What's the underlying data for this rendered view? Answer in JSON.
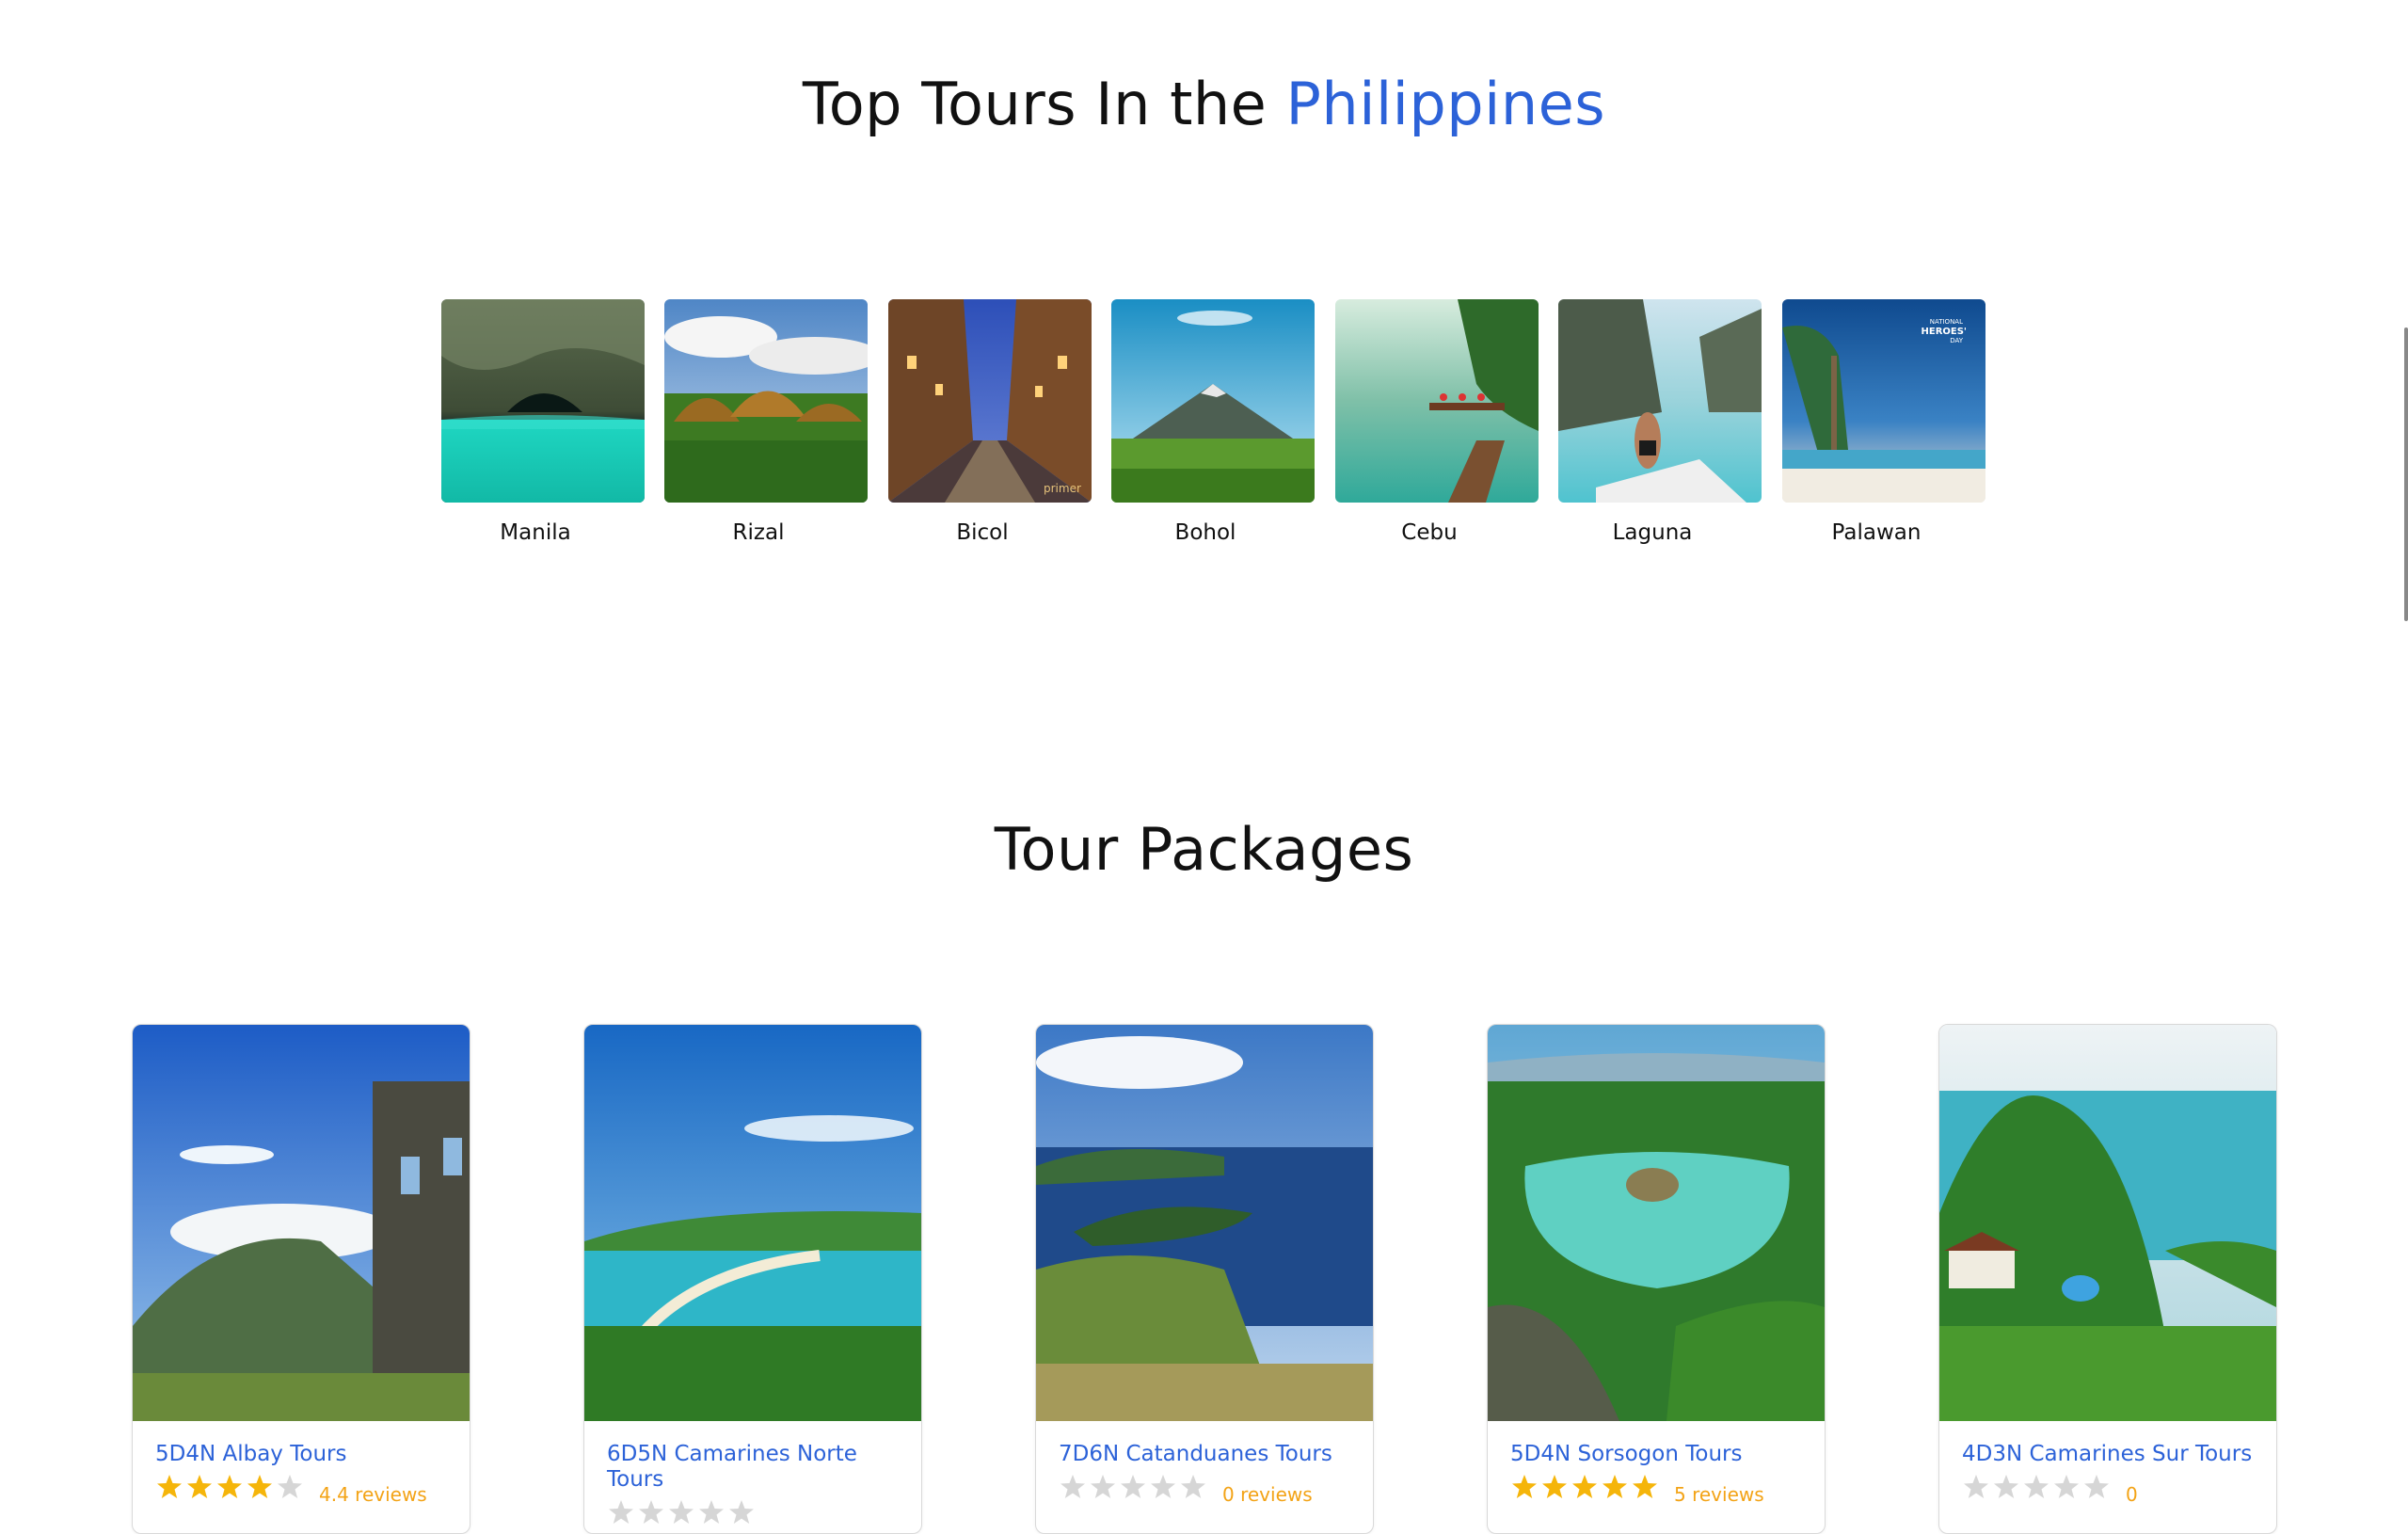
{
  "top_tours": {
    "title_prefix": "Top Tours In the",
    "title_accent": "Philippines",
    "destinations": [
      {
        "label": "Manila"
      },
      {
        "label": "Rizal"
      },
      {
        "label": "Bicol",
        "watermark": "primer"
      },
      {
        "label": "Bohol"
      },
      {
        "label": "Cebu"
      },
      {
        "label": "Laguna"
      },
      {
        "label": "Palawan",
        "badge_lines": [
          "NATIONAL",
          "HEROES'",
          "DAY"
        ]
      }
    ]
  },
  "packages": {
    "title": "Tour Packages",
    "cards": [
      {
        "title": "5D4N Albay Tours",
        "rating": 4,
        "rating_text": "4.4 reviews"
      },
      {
        "title": "6D5N Camarines Norte Tours",
        "rating": 0,
        "rating_text": ""
      },
      {
        "title": "7D6N Catanduanes Tours",
        "rating": 0,
        "rating_text": "0 reviews"
      },
      {
        "title": "5D4N Sorsogon Tours",
        "rating": 5,
        "rating_text": "5 reviews"
      },
      {
        "title": "4D3N Camarines Sur Tours",
        "rating": 0,
        "rating_text": "0"
      }
    ]
  },
  "colors": {
    "accent": "#2c62d8",
    "star_on": "#f5b50a",
    "star_off": "#d6d6d6"
  }
}
